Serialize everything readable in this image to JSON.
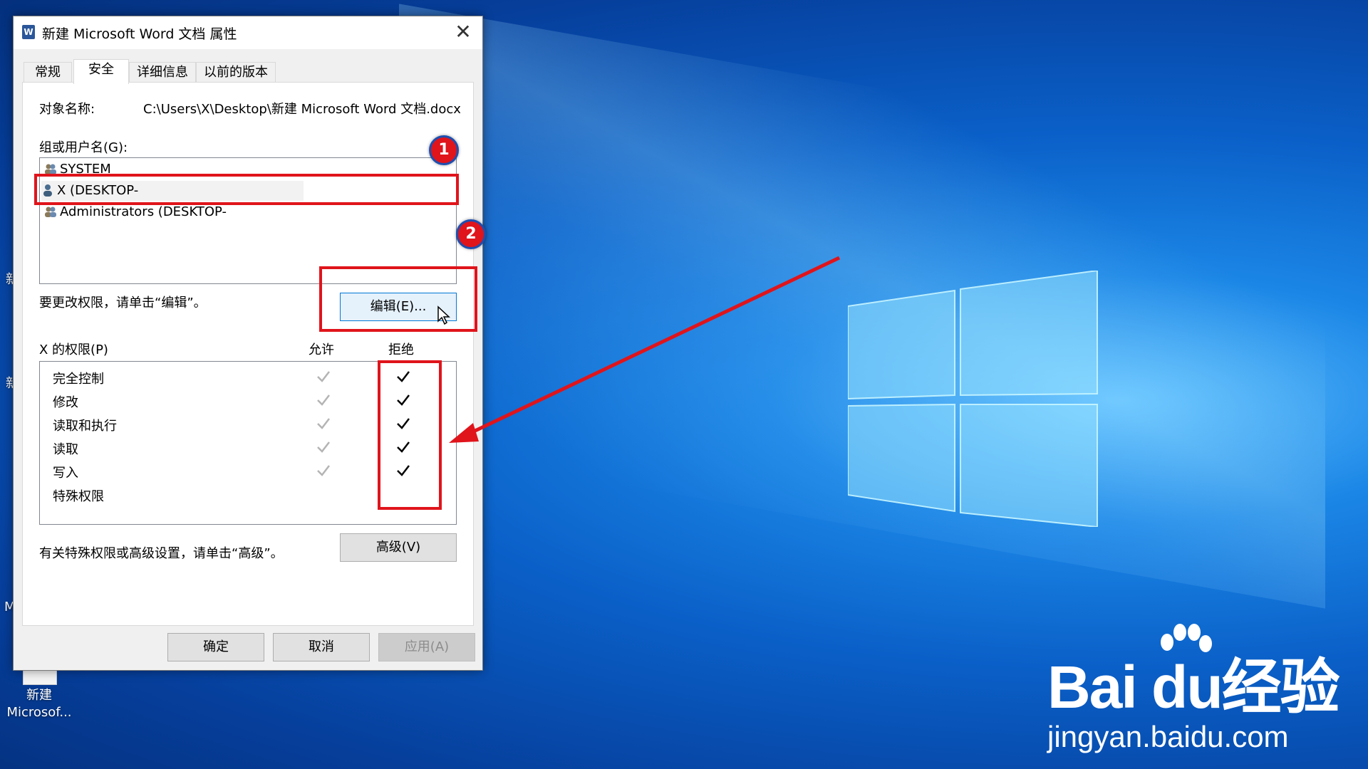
{
  "dialog": {
    "title": "新建 Microsoft Word 文档 属性",
    "close_glyph": "✕",
    "word_icon_letter": "W",
    "tabs": [
      {
        "label": "常规",
        "active": false
      },
      {
        "label": "安全",
        "active": true
      },
      {
        "label": "详细信息",
        "active": false
      },
      {
        "label": "以前的版本",
        "active": false
      }
    ],
    "object_name_label": "对象名称:",
    "object_name_value": "C:\\Users\\X\\Desktop\\新建 Microsoft Word 文档.docx",
    "group_label": "组或用户名(G):",
    "users": [
      {
        "name": "SYSTEM",
        "icon": "users-group-icon",
        "selected": false
      },
      {
        "name": "X (DESKTOP-",
        "icon": "user-icon",
        "selected": true
      },
      {
        "name": "Administrators (DESKTOP-",
        "icon": "users-group-icon",
        "selected": false
      }
    ],
    "edit_hint": "要更改权限，请单击“编辑”。",
    "edit_button": "编辑(E)...",
    "perm_label": "X 的权限(P)",
    "allow_header": "允许",
    "deny_header": "拒绝",
    "permissions": [
      {
        "name": "完全控制",
        "allow": "inherited",
        "deny": true
      },
      {
        "name": "修改",
        "allow": "inherited",
        "deny": true
      },
      {
        "name": "读取和执行",
        "allow": "inherited",
        "deny": true
      },
      {
        "name": "读取",
        "allow": "inherited",
        "deny": true
      },
      {
        "name": "写入",
        "allow": "inherited",
        "deny": true
      },
      {
        "name": "特殊权限",
        "allow": false,
        "deny": false
      }
    ],
    "advanced_hint": "有关特殊权限或高级设置，请单击“高级”。",
    "advanced_button": "高级(V)",
    "ok_button": "确定",
    "cancel_button": "取消",
    "apply_button": "应用(A)"
  },
  "annotations": {
    "badge1": "1",
    "badge2": "2",
    "highlight_color": "#e0141b"
  },
  "desktop": {
    "icon_left_1": "新",
    "icon_left_2": "新",
    "icon_left_3": "M",
    "shortcut_line1": "新建",
    "shortcut_line2": "Microsof..."
  },
  "watermark": {
    "brand": "Bai du经验",
    "url": "jingyan.baidu.com"
  }
}
